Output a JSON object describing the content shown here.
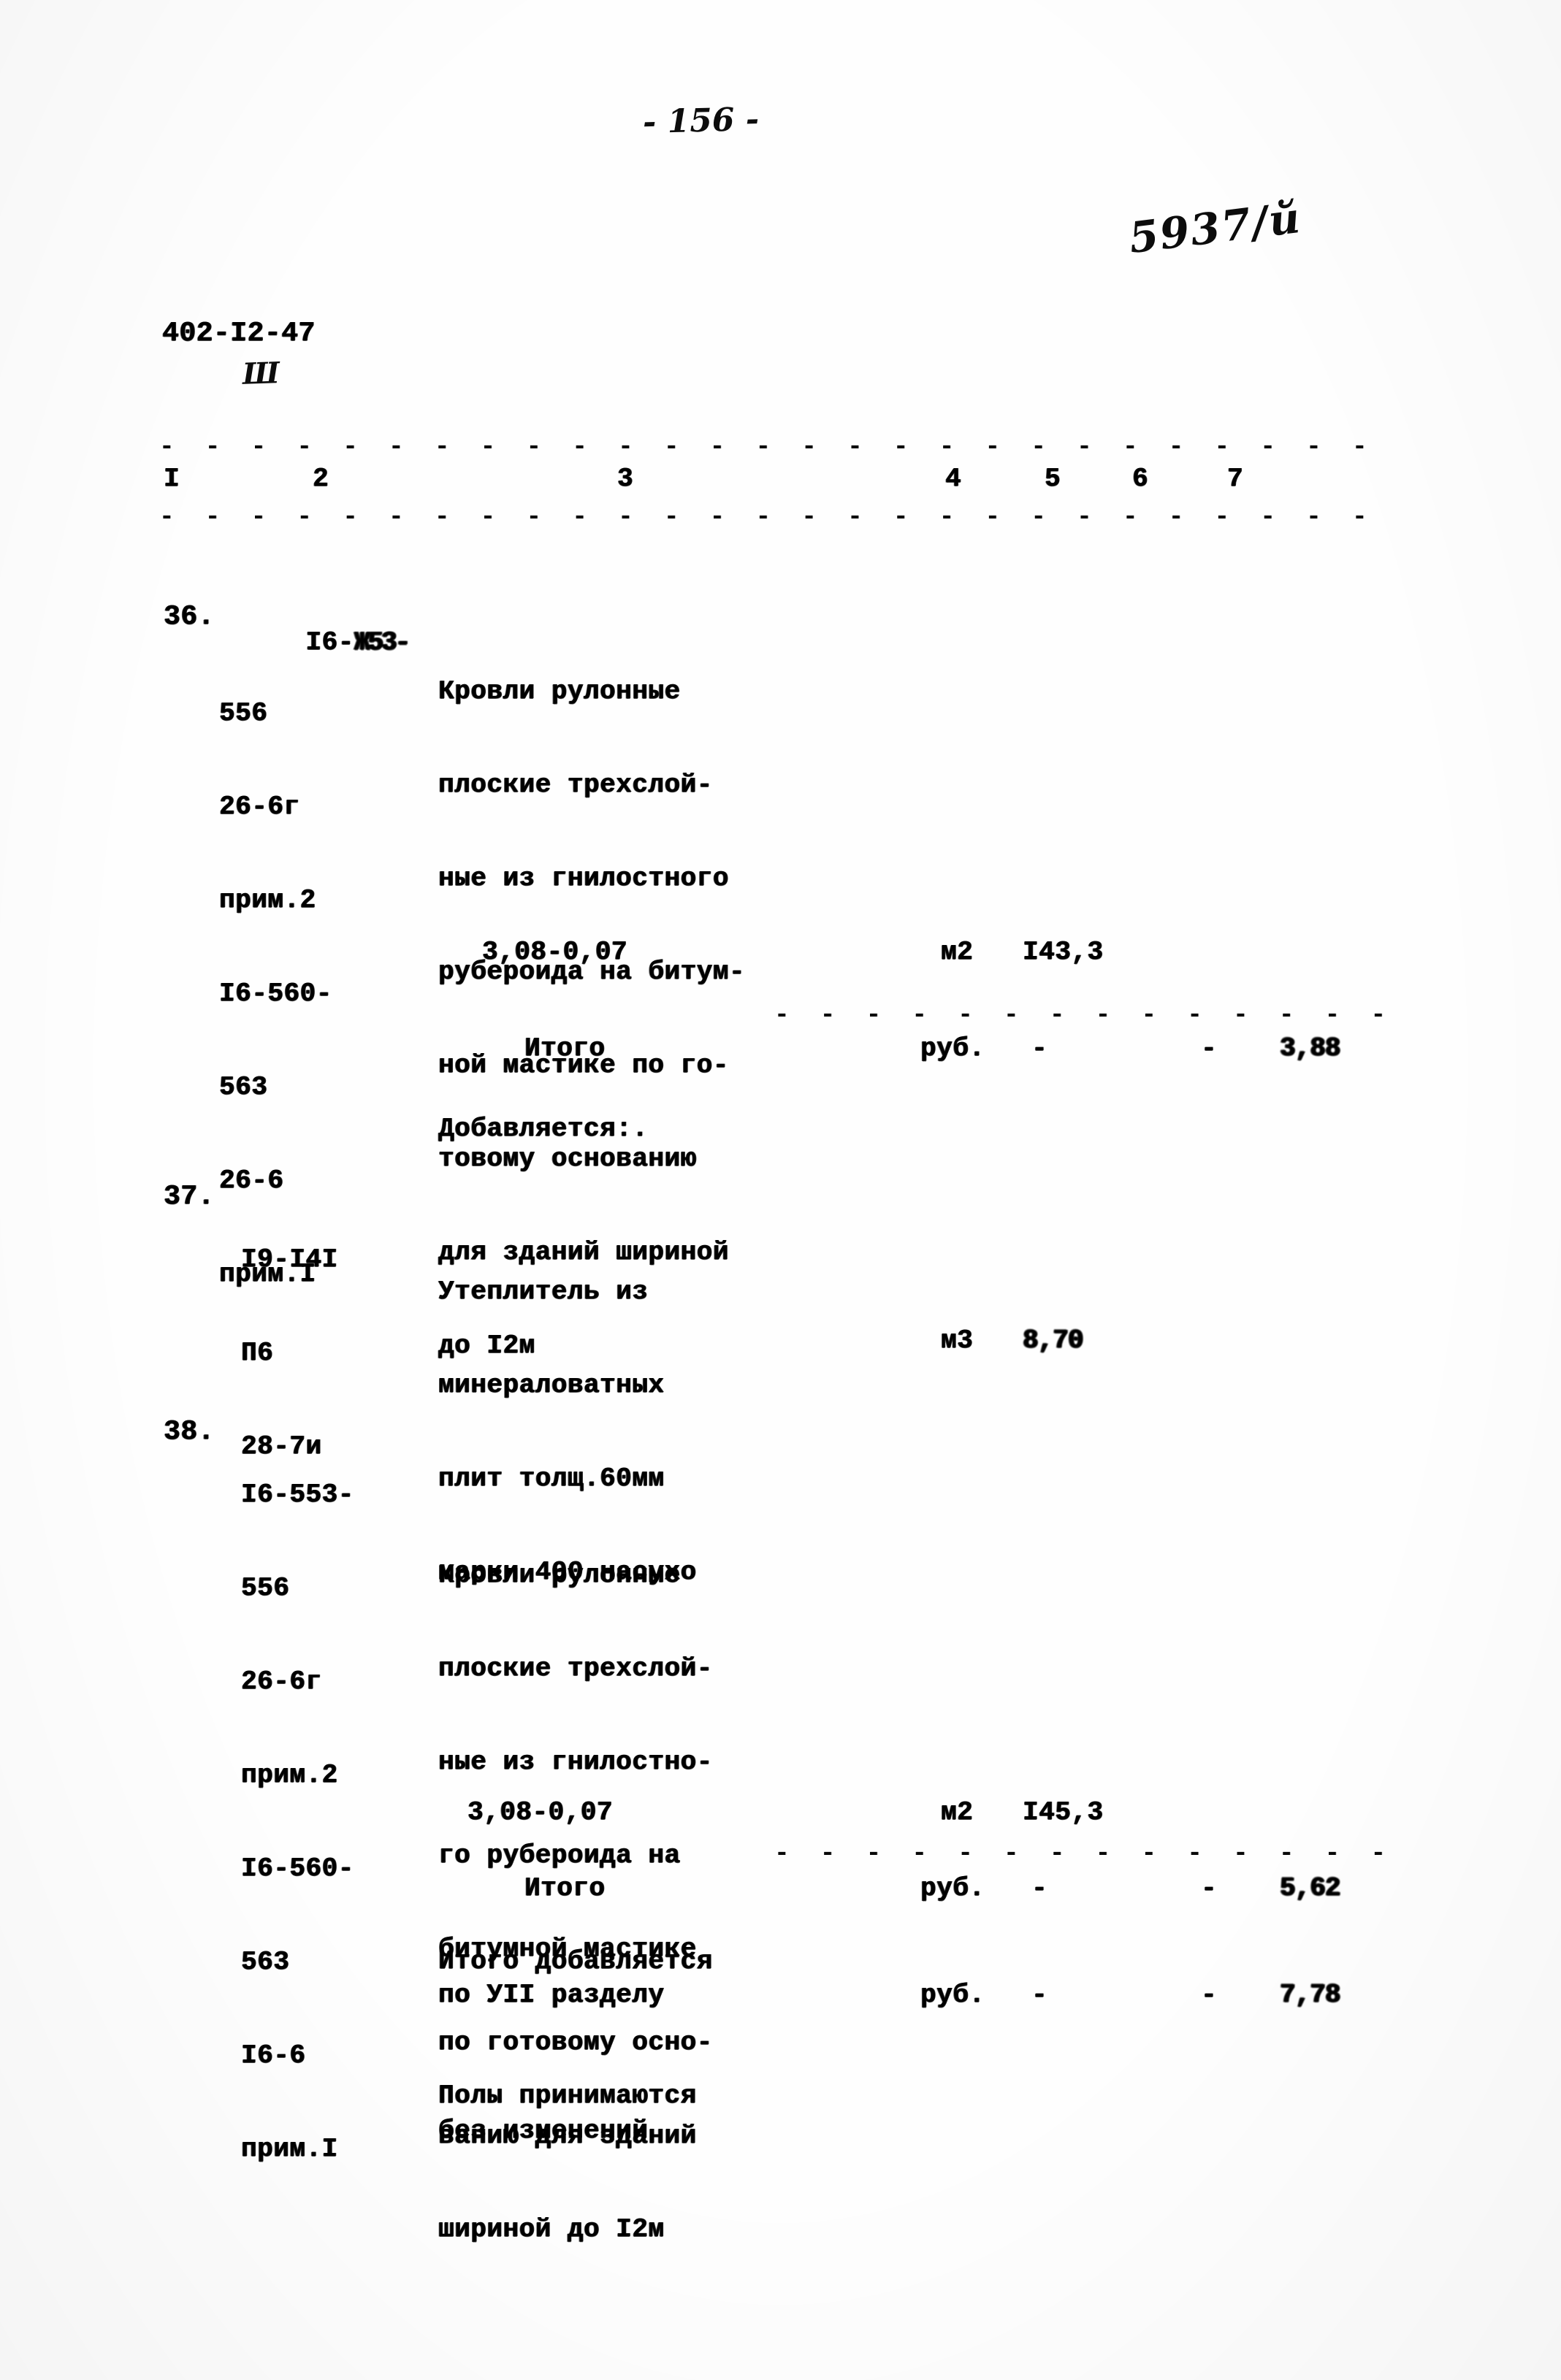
{
  "page": {
    "page_number_marker": "- 156 -",
    "handwritten_top_right": "5937/й",
    "document_code": "402-I2-47",
    "document_code_sub": "Ш"
  },
  "table": {
    "column_headers": [
      "I",
      "2",
      "3",
      "4",
      "5",
      "6",
      "7"
    ]
  },
  "items": [
    {
      "number": "36.",
      "codes": [
        "I6-553-",
        "556",
        "26-6г",
        "прим.2",
        "I6-560-",
        "563",
        "26-6",
        "прим.I"
      ],
      "code_first_overstruck": "I6-▒▒▒53-",
      "description_lines": [
        "Кровли рулонные",
        "плоские трехслой-",
        "ные из гнилостного",
        "рубероида на битум-",
        "ной мастике по го-",
        "товому основанию",
        "для зданий шириной",
        "до I2м"
      ],
      "formula": "3,08-0,07",
      "unit": "м2",
      "value": "I43,3",
      "total_label": "Итого",
      "total_unit": "руб.",
      "total_dash_1": "-",
      "total_dash_2": "-",
      "total_value": "3,88"
    },
    {
      "number": "37.",
      "codes": [
        "I9-I4I",
        "П6",
        "28-7и"
      ],
      "description_lines": [
        "Утеплитель из",
        "минераловатных",
        "плит толщ.60мм",
        "марки 400 насухо"
      ],
      "unit": "м3",
      "value": "8,70"
    },
    {
      "number": "38.",
      "codes": [
        "I6-553-",
        "556",
        "26-6г",
        "прим.2",
        "I6-560-",
        "563",
        "I6-6",
        "прим.I"
      ],
      "description_lines": [
        "Кровли рулонные",
        "плоские трехслой-",
        "ные из гнилостно-",
        "го рубероида на",
        "битумной мастике",
        "по готовому осно-",
        "ванию для зданий",
        "шириной до I2м"
      ],
      "formula": "3,08-0,07",
      "unit": "м2",
      "value": "I45,3",
      "total_label": "Итого",
      "total_unit": "руб.",
      "total_dash_1": "-",
      "total_dash_2": "-",
      "total_value": "5,62"
    }
  ],
  "notes": {
    "added_label": "Добавляется:.",
    "grand_total_line_1": "Итого добавляется",
    "grand_total_line_2": "по УII разделу",
    "grand_total_unit": "руб.",
    "grand_total_dash_1": "-",
    "grand_total_dash_2": "-",
    "grand_total_value": "7,78",
    "footer_line_1": "Полы принимаются",
    "footer_line_2": "без изменений"
  },
  "rules": {
    "dashes": "- - - - - - - - - - - - - - - - - - - - - - - - - - - - - - - - - -"
  }
}
